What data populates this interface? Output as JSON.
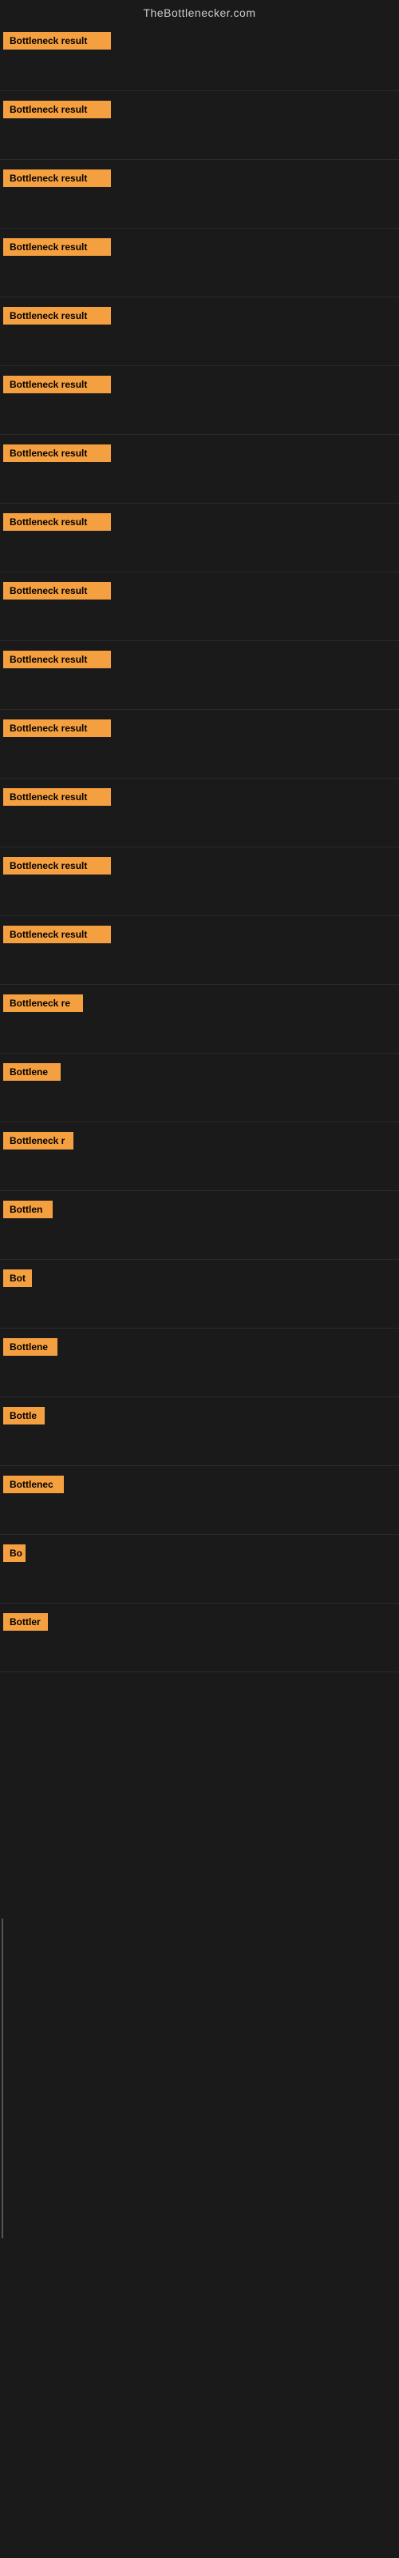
{
  "site": {
    "title": "TheBottlenecker.com"
  },
  "rows": [
    {
      "id": 1,
      "label": "Bottleneck result",
      "width": 135
    },
    {
      "id": 2,
      "label": "Bottleneck result",
      "width": 135
    },
    {
      "id": 3,
      "label": "Bottleneck result",
      "width": 135
    },
    {
      "id": 4,
      "label": "Bottleneck result",
      "width": 135
    },
    {
      "id": 5,
      "label": "Bottleneck result",
      "width": 135
    },
    {
      "id": 6,
      "label": "Bottleneck result",
      "width": 135
    },
    {
      "id": 7,
      "label": "Bottleneck result",
      "width": 135
    },
    {
      "id": 8,
      "label": "Bottleneck result",
      "width": 135
    },
    {
      "id": 9,
      "label": "Bottleneck result",
      "width": 135
    },
    {
      "id": 10,
      "label": "Bottleneck result",
      "width": 135
    },
    {
      "id": 11,
      "label": "Bottleneck result",
      "width": 135
    },
    {
      "id": 12,
      "label": "Bottleneck result",
      "width": 135
    },
    {
      "id": 13,
      "label": "Bottleneck result",
      "width": 135
    },
    {
      "id": 14,
      "label": "Bottleneck result",
      "width": 135
    },
    {
      "id": 15,
      "label": "Bottleneck re",
      "width": 100
    },
    {
      "id": 16,
      "label": "Bottlene",
      "width": 72
    },
    {
      "id": 17,
      "label": "Bottleneck r",
      "width": 88
    },
    {
      "id": 18,
      "label": "Bottlen",
      "width": 62
    },
    {
      "id": 19,
      "label": "Bot",
      "width": 36
    },
    {
      "id": 20,
      "label": "Bottlene",
      "width": 68
    },
    {
      "id": 21,
      "label": "Bottle",
      "width": 52
    },
    {
      "id": 22,
      "label": "Bottlenec",
      "width": 76
    },
    {
      "id": 23,
      "label": "Bo",
      "width": 28
    },
    {
      "id": 24,
      "label": "Bottler",
      "width": 56
    }
  ],
  "colors": {
    "bar_bg": "#f5a040",
    "bar_text": "#000000",
    "page_bg": "#1a1a1a",
    "title_text": "#cccccc"
  }
}
